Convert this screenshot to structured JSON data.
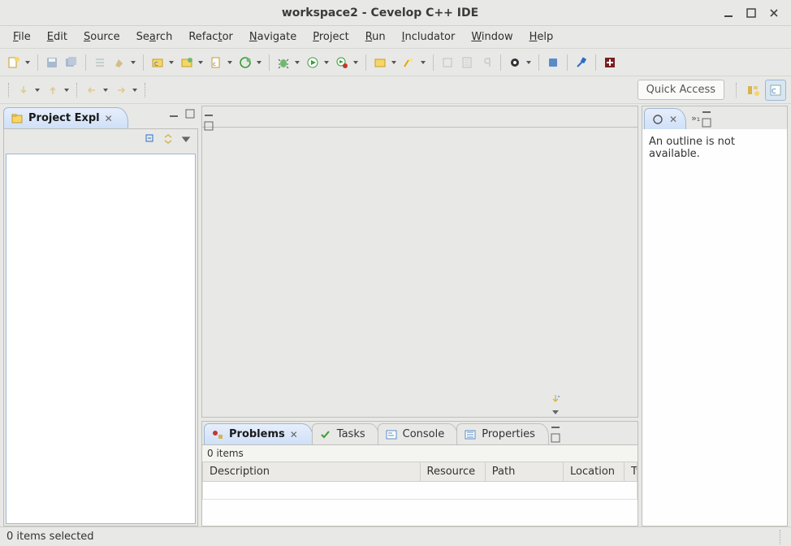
{
  "window": {
    "title": "workspace2 - Cevelop C++ IDE"
  },
  "menu": {
    "file": "File",
    "edit": "Edit",
    "source": "Source",
    "search": "Search",
    "refactor": "Refactor",
    "navigate": "Navigate",
    "project": "Project",
    "run": "Run",
    "includator": "Includator",
    "window": "Window",
    "help": "Help"
  },
  "toolbar": {
    "quick_access": "Quick Access"
  },
  "views": {
    "project_explorer": {
      "label": "Project Expl"
    },
    "outline": {
      "label": "O",
      "empty_msg": "An outline is not available."
    },
    "problems": {
      "label": "Problems",
      "summary": "0 items"
    },
    "tasks": {
      "label": "Tasks"
    },
    "console": {
      "label": "Console"
    },
    "properties": {
      "label": "Properties"
    }
  },
  "problems_table": {
    "columns": [
      "Description",
      "Resource",
      "Path",
      "Location",
      "Type"
    ],
    "rows": []
  },
  "status": {
    "selection": "0 items selected"
  }
}
